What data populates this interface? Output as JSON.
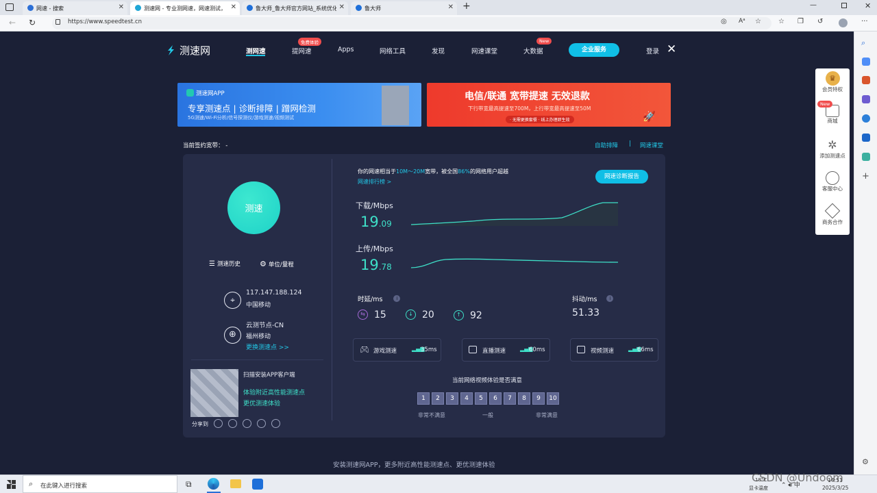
{
  "browser": {
    "tabs": [
      {
        "label": "网速 - 搜索",
        "icon": "search-icon",
        "active": false
      },
      {
        "label": "测速网 - 专业测网速，网速测试，宽",
        "icon": "speedtest-icon",
        "active": true
      },
      {
        "label": "鲁大师_鲁大师官方网站_系统优化",
        "icon": "ludashi-icon",
        "active": false
      },
      {
        "label": "鲁大师",
        "icon": "ludashi-icon",
        "active": false
      }
    ],
    "url": "https://www.speedtest.cn"
  },
  "header": {
    "logo": "测速网",
    "nav": [
      "测网速",
      "提网速",
      "Apps",
      "网络工具",
      "发现",
      "网速课堂",
      "大数据"
    ],
    "badge_free": "免费体验",
    "badge_new": "New",
    "enterprise": "企业服务",
    "login": "登录"
  },
  "banners": {
    "left": {
      "app": "测速网APP",
      "headline": "专享测速点 | 诊断排障 | 蹭网检测",
      "sub": "5G测速/Wi-Fi分析/信号探测仪/游戏测速/视频测试"
    },
    "right": {
      "headline": "电信/联通 宽带提速 无效退款",
      "sub": "下行带宽最高提速至700M，上行带宽最高提速至50M",
      "small": "· 无需更换套餐 · 线上办理即生效"
    }
  },
  "contract": {
    "label": "当前签约宽带：",
    "value": "-"
  },
  "links": {
    "self_fix": "自助排障",
    "sep": "|",
    "course": "网速课堂"
  },
  "left_panel": {
    "start": "测速",
    "history": "测速历史",
    "unit": "单位/量程",
    "ip": "117.147.188.124",
    "isp": "中国移动",
    "node": "云测节点-CN",
    "node_isp": "福州移动",
    "change_node": "更换测速点 >>",
    "scan": "扫描安装APP客户端",
    "promo1": "体验附近高性能测速点",
    "promo2": "更优测速体验",
    "share": "分享到"
  },
  "result": {
    "compare_prefix": "你的网速相当于",
    "compare_range": "10M～20M",
    "compare_mid": "宽带，被全国",
    "compare_pct": "86%",
    "compare_suffix": "的网络用户超越",
    "rank": "网速排行榜 >",
    "report": "网速诊断报告",
    "download_label": "下载/Mbps",
    "download_int": "19",
    "download_dec": ".09",
    "upload_label": "上传/Mbps",
    "upload_int": "19",
    "upload_dec": ".78",
    "latency_label": "时延/ms",
    "latency_values": [
      "15",
      "20",
      "92"
    ],
    "jitter_label": "抖动/ms",
    "jitter_value": "51.33",
    "tests": [
      {
        "label": "游戏测速",
        "value": "35ms",
        "icon": "gamepad-icon"
      },
      {
        "label": "直播测速",
        "value": "60ms",
        "icon": "live-icon"
      },
      {
        "label": "视频测速",
        "value": "66ms",
        "icon": "video-icon"
      }
    ],
    "survey_title": "当前网络视频体验是否满意",
    "scores": [
      "1",
      "2",
      "3",
      "4",
      "5",
      "6",
      "7",
      "8",
      "9",
      "10"
    ],
    "scale": [
      "非常不满意",
      "一般",
      "非常满意"
    ]
  },
  "right_sidebar": [
    {
      "label": "会员特权",
      "icon": "crown-icon"
    },
    {
      "label": "商城",
      "icon": "shop-icon",
      "badge": "New"
    },
    {
      "label": "添加测速点",
      "icon": "add-node-icon"
    },
    {
      "label": "客服中心",
      "icon": "headset-icon"
    },
    {
      "label": "商务合作",
      "icon": "handshake-icon"
    }
  ],
  "footer": "安装测速网APP，更多附近高性能测速点、更优测速体验",
  "taskbar": {
    "search": "在此键入进行搜索",
    "weather": "18°C",
    "weather2": "显卡温度",
    "time": "14:51",
    "date": "2025/3/25",
    "watermark": "CSDN @Undoom"
  },
  "colors": {
    "accent": "#22c9e8",
    "bg": "#1b2036",
    "card": "#262c47",
    "badge": "#f04d4d"
  }
}
